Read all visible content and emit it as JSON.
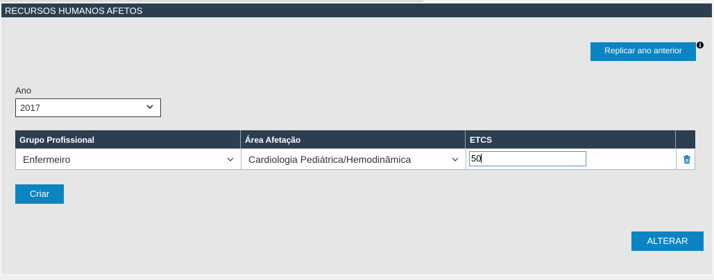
{
  "panel": {
    "title": "RECURSOS HUMANOS AFETOS",
    "replicar_label": "Replicar ano anterior",
    "info_icon": "i"
  },
  "ano": {
    "label": "Ano",
    "selected": "2017"
  },
  "table": {
    "headers": [
      "Grupo Profissional",
      "Área Afetação",
      "ETCS"
    ],
    "rows": [
      {
        "grupo": "Enfermeiro",
        "area": "Cardiologia Pediátrica/Hemodinâmica",
        "etcs": "50"
      }
    ]
  },
  "actions": {
    "criar": "Criar",
    "alterar": "ALTERAR"
  },
  "colors": {
    "header_bg": "#2c3e4f",
    "button_bg": "#0b84c3",
    "panel_bg": "#e6e6e6"
  },
  "icons": {
    "dropdown": "chevron-down-icon",
    "delete": "trash-icon",
    "info": "info-icon"
  }
}
